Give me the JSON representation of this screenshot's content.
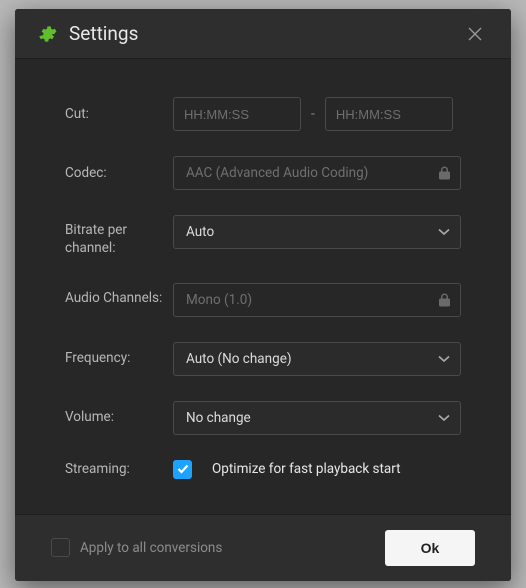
{
  "title": "Settings",
  "rows": {
    "cut": {
      "label": "Cut:",
      "start_ph": "HH:MM:SS",
      "end_ph": "HH:MM:SS",
      "sep": "-"
    },
    "codec": {
      "label": "Codec:",
      "value": "AAC (Advanced Audio Coding)"
    },
    "bitrate": {
      "label": "Bitrate per channel:",
      "value": "Auto"
    },
    "channels": {
      "label": "Audio Channels:",
      "value": "Mono (1.0)"
    },
    "frequency": {
      "label": "Frequency:",
      "value": "Auto (No change)"
    },
    "volume": {
      "label": "Volume:",
      "value": "No change"
    },
    "streaming": {
      "label": "Streaming:",
      "checkbox_label": "Optimize for fast playback start",
      "checked": true
    }
  },
  "footer": {
    "apply_label": "Apply to all conversions",
    "apply_checked": false,
    "ok": "Ok"
  },
  "colors": {
    "accent_green": "#5fbf2a",
    "accent_blue": "#1ea2ff",
    "bg": "#272727"
  }
}
